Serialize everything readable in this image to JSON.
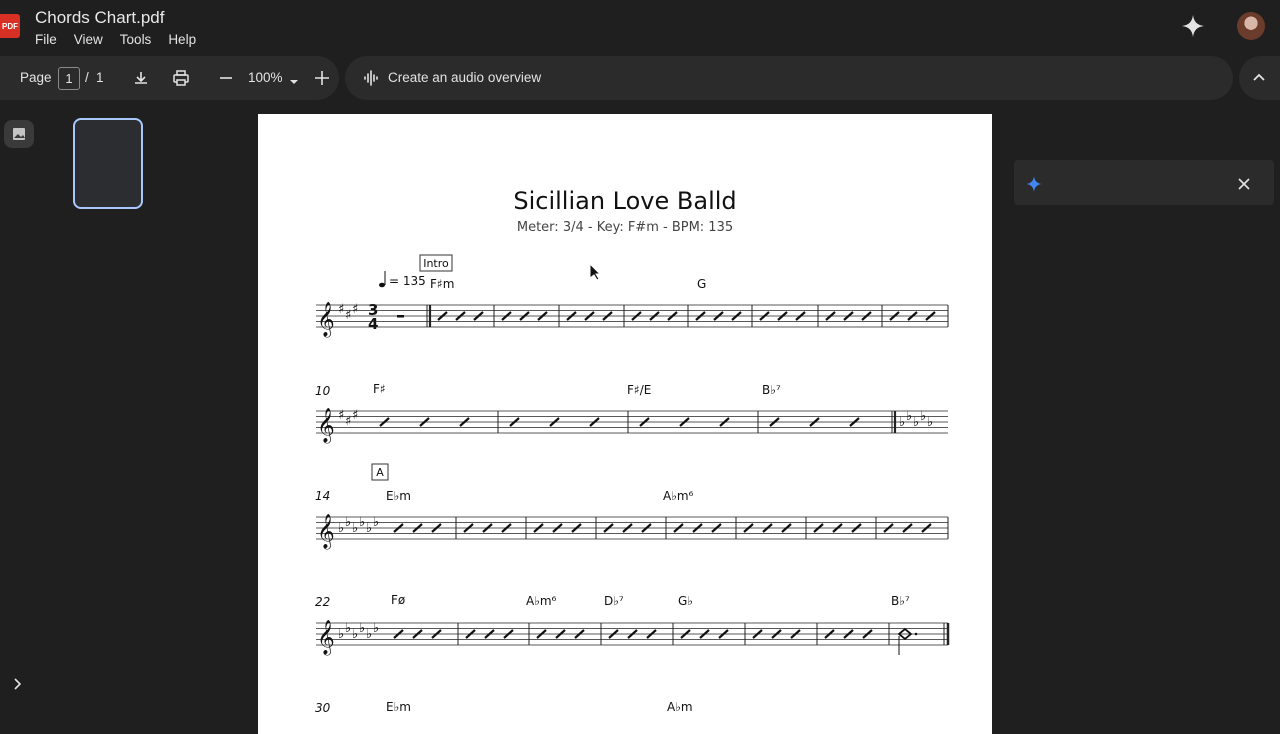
{
  "app": {
    "file_badge": "PDF",
    "title": "Chords Chart.pdf",
    "menu": [
      "File",
      "View",
      "Tools",
      "Help"
    ],
    "gemini_icon": "sparkle-icon",
    "avatar_icon": "user-avatar"
  },
  "toolbar": {
    "page_label": "Page",
    "page_current": "1",
    "page_sep": "/",
    "page_total": "1",
    "download_icon": "download-icon",
    "print_icon": "print-icon",
    "zoom": "100%",
    "zoom_out_icon": "minus-icon",
    "zoom_in_icon": "plus-icon",
    "audio_label": "Create an audio overview",
    "collapse_icon": "chevron-up-icon"
  },
  "sheet": {
    "title": "Sicillian Love Balld",
    "subtitle": "Meter: 3/4 - Key: F#m  - BPM: 135",
    "tempo": "= 135",
    "meter_top": "3",
    "meter_bottom": "4",
    "rehearsal": [
      "Intro",
      "A"
    ],
    "systems": [
      {
        "measure": "",
        "chords": [
          "F♯m",
          "G"
        ]
      },
      {
        "measure": "10",
        "chords": [
          "F♯",
          "F♯/E",
          "B♭⁷"
        ]
      },
      {
        "measure": "14",
        "chords": [
          "E♭m",
          "A♭m⁶"
        ]
      },
      {
        "measure": "22",
        "chords": [
          "Fø",
          "A♭m⁶",
          "D♭⁷",
          "G♭",
          "B♭⁷"
        ]
      },
      {
        "measure": "30",
        "chords": [
          "E♭m",
          "A♭m"
        ]
      }
    ]
  },
  "colors": {
    "accent": "#a8c7fa",
    "gemini": "#4285f4",
    "bg": "#1f1f1f",
    "toolbar": "#2b2b2b"
  }
}
